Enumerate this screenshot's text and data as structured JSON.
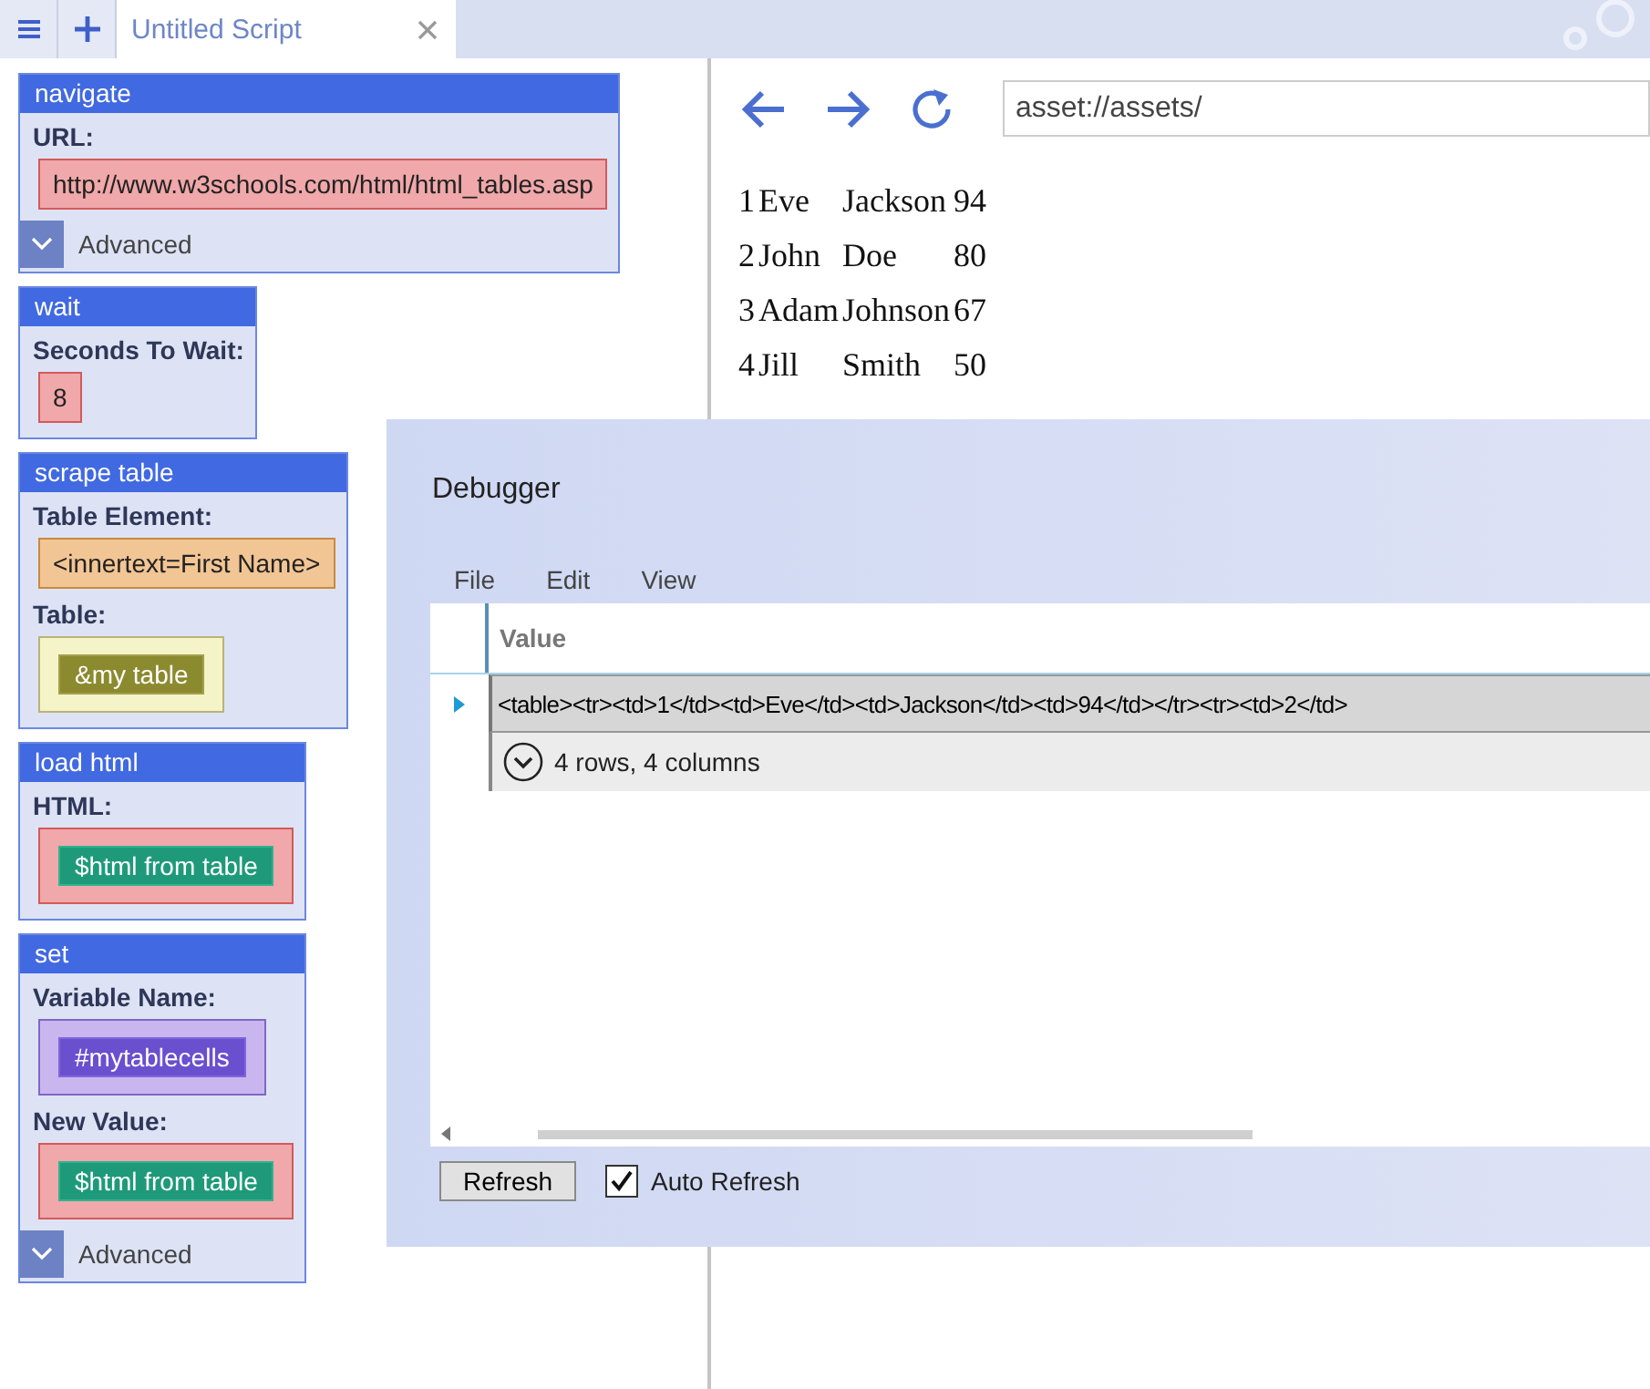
{
  "tab_bar": {
    "tabs": [
      {
        "title": "Untitled Script",
        "selected": true
      }
    ]
  },
  "script_blocks": [
    {
      "title": "navigate",
      "fields": [
        {
          "label": "URL:",
          "kind": "literal",
          "value": "http://www.w3schools.com/html/html_tables.asp"
        }
      ],
      "advanced": {
        "label": "Advanced",
        "expanded": false
      }
    },
    {
      "title": "wait",
      "fields": [
        {
          "label": "Seconds To Wait:",
          "kind": "literal",
          "value": "8"
        }
      ]
    },
    {
      "title": "scrape table",
      "fields": [
        {
          "label": "Table Element:",
          "kind": "selector",
          "value": "<innertext=First Name>"
        },
        {
          "label": "Table:",
          "kind": "table-variable",
          "value": "&my table"
        }
      ]
    },
    {
      "title": "load html",
      "fields": [
        {
          "label": "HTML:",
          "kind": "text-variable",
          "value": "$html from table"
        }
      ]
    },
    {
      "title": "set",
      "fields": [
        {
          "label": "Variable Name:",
          "kind": "name-variable",
          "value": "#mytablecells"
        },
        {
          "label": "New Value:",
          "kind": "text-variable",
          "value": "$html from table"
        }
      ],
      "advanced": {
        "label": "Advanced",
        "expanded": false
      }
    }
  ],
  "browser": {
    "address": "asset://assets/",
    "table_rows": [
      [
        "1",
        "Eve",
        "Jackson",
        "94"
      ],
      [
        "2",
        "John",
        "Doe",
        "80"
      ],
      [
        "3",
        "Adam",
        "Johnson",
        "67"
      ],
      [
        "4",
        "Jill",
        "Smith",
        "50"
      ]
    ]
  },
  "debugger": {
    "title": "Debugger",
    "menu": [
      "File",
      "Edit",
      "View"
    ],
    "columns": [
      "Value"
    ],
    "rows": [
      {
        "value": "<table><tr><td>1</td><td>Eve</td><td>Jackson</td><td>94</td></tr><tr><td>2</td>",
        "selected": true,
        "summary": "4 rows, 4 columns",
        "expanded": false
      }
    ],
    "refresh_button": "Refresh",
    "auto_refresh": {
      "label": "Auto Refresh",
      "checked": true
    }
  }
}
